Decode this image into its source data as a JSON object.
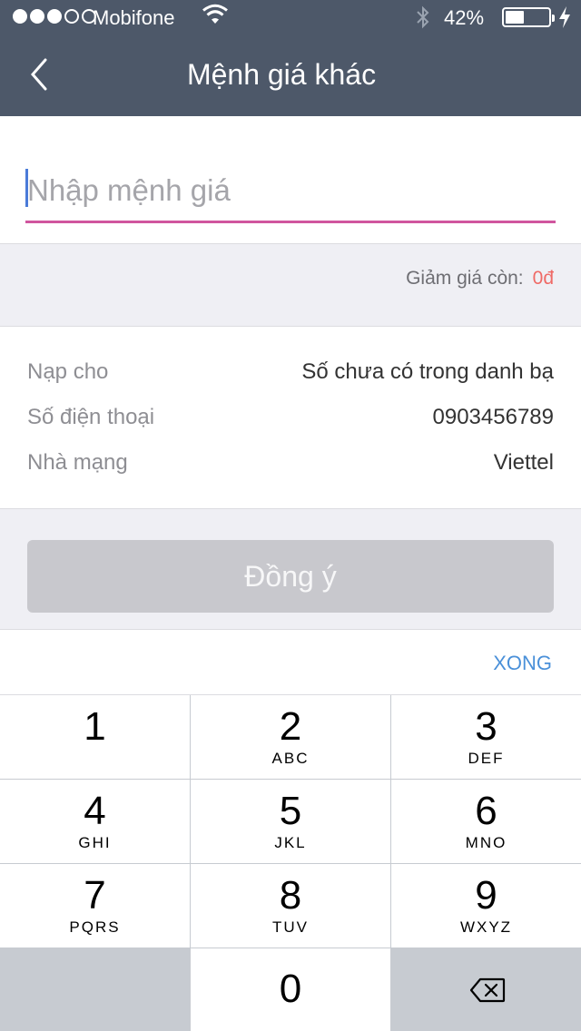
{
  "status_bar": {
    "carrier": "Mobifone",
    "battery_percent": "42%",
    "battery_level": 0.42,
    "signal_bars_filled": 3,
    "signal_bars_total": 5
  },
  "nav": {
    "title": "Mệnh giá khác",
    "back_icon": "chevron-left-icon"
  },
  "amount_input": {
    "placeholder": "Nhập mệnh giá",
    "value": ""
  },
  "discount": {
    "label": "Giảm giá còn:",
    "value": "0đ"
  },
  "info": {
    "rows": [
      {
        "label": "Nạp cho",
        "value": "Số chưa có trong danh bạ"
      },
      {
        "label": "Số điện thoại",
        "value": "0903456789"
      },
      {
        "label": "Nhà mạng",
        "value": "Viettel"
      }
    ]
  },
  "confirm_button": "Đồng ý",
  "done_button": "XONG",
  "keypad": {
    "keys": [
      {
        "num": "1",
        "letters": ""
      },
      {
        "num": "2",
        "letters": "ABC"
      },
      {
        "num": "3",
        "letters": "DEF"
      },
      {
        "num": "4",
        "letters": "GHI"
      },
      {
        "num": "5",
        "letters": "JKL"
      },
      {
        "num": "6",
        "letters": "MNO"
      },
      {
        "num": "7",
        "letters": "PQRS"
      },
      {
        "num": "8",
        "letters": "TUV"
      },
      {
        "num": "9",
        "letters": "WXYZ"
      },
      {
        "num": "0",
        "letters": ""
      }
    ],
    "delete_icon": "backspace-icon"
  },
  "colors": {
    "nav_bg": "#4d5869",
    "input_underline": "#d0559e",
    "discount_value": "#ef6a66",
    "done_link": "#4a90d9",
    "confirm_disabled": "#c8c8cd"
  }
}
